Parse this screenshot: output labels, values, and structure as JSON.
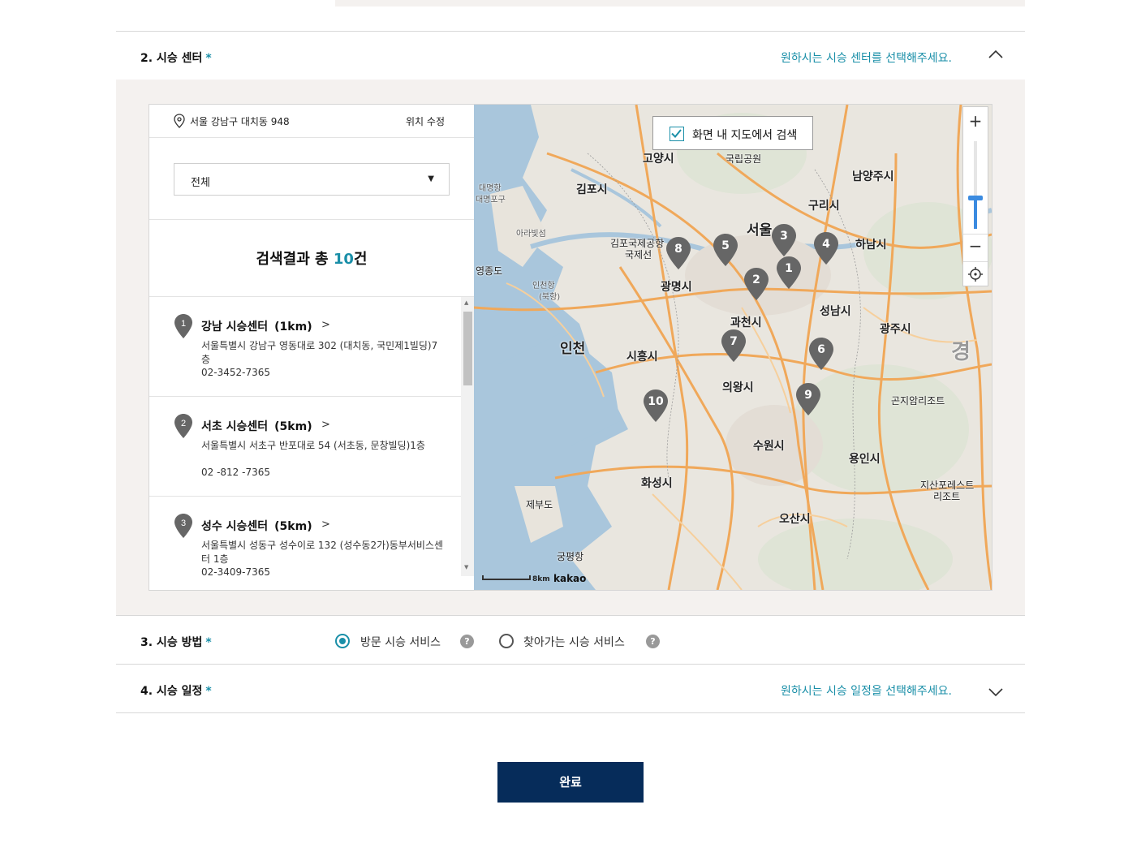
{
  "section2": {
    "title": "2. 시승 센터",
    "required": "*",
    "hint": "원하시는 시승 센터를 선택해주세요."
  },
  "location": {
    "address": "서울 강남구 대치동 948",
    "edit_label": "위치 수정"
  },
  "filter": {
    "selected": "전체"
  },
  "results": {
    "prefix": "검색결과 총 ",
    "count": "10",
    "suffix": "건"
  },
  "centers": [
    {
      "no": "1",
      "name": "강남 시승센터",
      "dist": "(1km)",
      "address": "서울특별시 강남구 영동대로 302 (대치동, 국민제1빌딩)7층",
      "phone": "02-3452-7365"
    },
    {
      "no": "2",
      "name": "서초 시승센터",
      "dist": "(5km)",
      "address": "서울특별시 서초구 반포대로 54 (서초동, 문창빌딩)1층",
      "phone": "02 -812 -7365"
    },
    {
      "no": "3",
      "name": "성수 시승센터",
      "dist": "(5km)",
      "address": "서울특별시 성동구 성수이로 132 (성수동2가)동부서비스센터 1층",
      "phone": "02-3409-7365"
    }
  ],
  "map": {
    "search_in_map": "화면 내 지도에서 검색",
    "zoom_in": "+",
    "zoom_out": "−",
    "scale": "8km",
    "brand": "kakao",
    "places": {
      "goyang": "고양시",
      "gimpo": "김포시",
      "seoul": "서울",
      "namyangju": "남양주시",
      "guri": "구리시",
      "hanam": "하남시",
      "gwangmyeong": "광명시",
      "incheon": "인천",
      "siheung": "시흥시",
      "gwacheon": "과천시",
      "seongnam": "성남시",
      "gwangju": "광주시",
      "uiwang": "의왕시",
      "suwon": "수원시",
      "yongin": "용인시",
      "hwaseong": "화성시",
      "osan": "오산시",
      "gimpo_airport": "김포국제공항",
      "national_line": "국제선",
      "jebudo": "제부도",
      "gungpyeong": "궁평항",
      "yeongjongdo": "영종도",
      "arabitseom": "아라빛섬",
      "gonjiam": "곤지암리조트",
      "jisan": "지산포레스트",
      "jisan2": "리조트",
      "gyeong": "경",
      "daemyeong": "대명항",
      "daemyeongpo": "대명포구",
      "gukrip": "국립공원",
      "incheon_port": "인천항",
      "bukhang": "(북항)"
    },
    "markers": [
      "1",
      "2",
      "3",
      "4",
      "5",
      "6",
      "7",
      "8",
      "9",
      "10"
    ]
  },
  "section3": {
    "title": "3. 시승 방법",
    "required": "*",
    "options": [
      "방문 시승 서비스",
      "찾아가는 시승 서비스"
    ],
    "selected_index": 0,
    "help": "?"
  },
  "section4": {
    "title": "4. 시승 일정",
    "required": "*",
    "hint": "원하시는 시승 일정을 선택해주세요."
  },
  "submit_label": "완료",
  "colors": {
    "accent": "#1a8fa8",
    "button": "#062c5a",
    "panel": "#f4f1ef",
    "marker": "#666666"
  }
}
